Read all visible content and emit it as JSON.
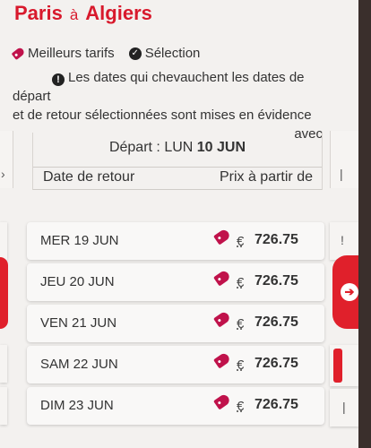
{
  "header": {
    "from": "Paris",
    "separator": "à",
    "to": "Algiers"
  },
  "legend": {
    "best_prices": "Meilleurs tarifs",
    "selection": "Sélection"
  },
  "notice": {
    "line1": "Les dates qui chevauchent les dates de départ",
    "line2": "et de retour sélectionnées sont mises en évidence",
    "line3": "avec"
  },
  "table": {
    "departure_label": "Départ : LUN",
    "departure_date": "10 JUN",
    "col_return": "Date de retour",
    "col_price": "Prix à partir de",
    "rows": [
      {
        "date": "MER 19 JUN",
        "currency": "€",
        "price": "726.75"
      },
      {
        "date": "JEU 20 JUN",
        "currency": "€",
        "price": "726.75"
      },
      {
        "date": "VEN 21 JUN",
        "currency": "€",
        "price": "726.75"
      },
      {
        "date": "SAM 22 JUN",
        "currency": "€",
        "price": "726.75"
      },
      {
        "date": "DIM 23 JUN",
        "currency": "€",
        "price": "726.75"
      }
    ]
  },
  "icons": {
    "tag": "price-tag-icon",
    "check": "check-circle-icon",
    "info": "exclamation-circle-icon",
    "next": "arrow-right-circle-icon"
  },
  "colors": {
    "brand_red": "#d8192c",
    "tag_pink": "#c0124b",
    "text": "#333333",
    "background": "#f3f1ef"
  }
}
